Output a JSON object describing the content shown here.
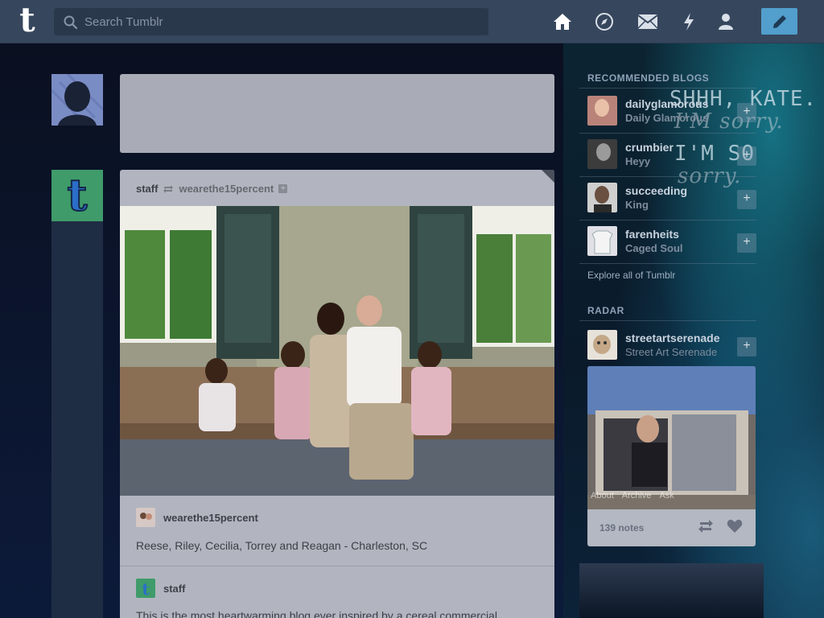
{
  "header": {
    "logo_letter": "t",
    "search_placeholder": "Search Tumblr",
    "nav": [
      "home-icon",
      "explore-compass-icon",
      "inbox-mail-icon",
      "activity-lightning-icon",
      "account-person-icon"
    ],
    "compose_icon": "pencil-icon"
  },
  "background_quote": {
    "line1": "SHHH, KATE.",
    "line2": "I'M sorry.",
    "line3": "I'M SO",
    "line4": "sorry."
  },
  "post": {
    "author": "staff",
    "reblogged_from": "wearethe15percent",
    "reblog_user": "wearethe15percent",
    "caption": "Reese, Riley, Cecilia, Torrey and Reagan - Charleston, SC",
    "staff_user": "staff",
    "body": "This is the most heartwarming blog ever inspired by a cereal commercial."
  },
  "sidebar": {
    "recommended_title": "RECOMMENDED BLOGS",
    "blogs": [
      {
        "name": "dailyglamorous",
        "subtitle": "Daily Glamorous"
      },
      {
        "name": "crumbier",
        "subtitle": "Heyy"
      },
      {
        "name": "succeeding",
        "subtitle": "King"
      },
      {
        "name": "farenheits",
        "subtitle": "Caged Soul"
      }
    ],
    "explore_link": "Explore all of Tumblr",
    "radar_title": "RADAR",
    "radar_blog": {
      "name": "streetartserenade",
      "subtitle": "Street Art Serenade"
    },
    "radar_notes": "139 notes",
    "radar_overlay": [
      "About",
      "Archive",
      "Ask"
    ]
  },
  "colors": {
    "header_bg": "#36465d",
    "accent_blue": "#529ecc",
    "page_bg": "#081427"
  }
}
